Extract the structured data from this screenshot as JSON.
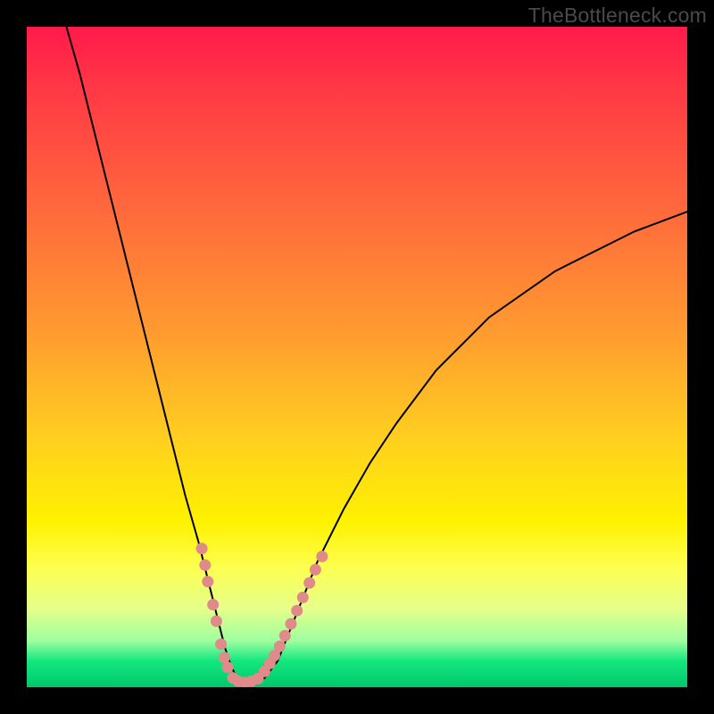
{
  "watermark": "TheBottleneck.com",
  "chart_data": {
    "type": "line",
    "title": "",
    "xlabel": "",
    "ylabel": "",
    "xlim": [
      0,
      100
    ],
    "ylim": [
      0,
      100
    ],
    "curve": {
      "name": "bottleneck-curve",
      "x": [
        6,
        8,
        10,
        12,
        14,
        16,
        18,
        20,
        22,
        24,
        26,
        28,
        29,
        30,
        31,
        32,
        33,
        34,
        36,
        38,
        40,
        44,
        48,
        52,
        56,
        62,
        70,
        80,
        92,
        100
      ],
      "y": [
        100,
        93,
        85,
        77,
        69,
        61,
        53,
        45,
        37,
        29,
        22,
        14,
        10,
        6,
        3,
        1.2,
        0.7,
        0.7,
        1.4,
        4,
        9,
        19,
        27,
        34,
        40,
        48,
        56,
        63,
        69,
        72
      ]
    },
    "marker_groups": [
      {
        "name": "left-edge-markers",
        "points": [
          {
            "x": 26.5,
            "y": 21
          },
          {
            "x": 27.0,
            "y": 18.5
          },
          {
            "x": 27.4,
            "y": 16
          },
          {
            "x": 28.2,
            "y": 12.5
          },
          {
            "x": 28.7,
            "y": 10
          },
          {
            "x": 29.4,
            "y": 6.5
          },
          {
            "x": 29.9,
            "y": 4.5
          },
          {
            "x": 30.4,
            "y": 3.0
          }
        ]
      },
      {
        "name": "trough-markers",
        "points": [
          {
            "x": 31.2,
            "y": 1.4
          },
          {
            "x": 32.0,
            "y": 0.9
          },
          {
            "x": 33.0,
            "y": 0.7
          },
          {
            "x": 34.0,
            "y": 0.9
          },
          {
            "x": 35.0,
            "y": 1.3
          }
        ]
      },
      {
        "name": "right-edge-markers",
        "points": [
          {
            "x": 36.0,
            "y": 2.4
          },
          {
            "x": 36.8,
            "y": 3.6
          },
          {
            "x": 37.5,
            "y": 4.8
          },
          {
            "x": 38.3,
            "y": 6.2
          },
          {
            "x": 39.1,
            "y": 7.8
          },
          {
            "x": 40.0,
            "y": 9.6
          },
          {
            "x": 40.9,
            "y": 11.6
          },
          {
            "x": 41.8,
            "y": 13.6
          },
          {
            "x": 42.8,
            "y": 15.8
          },
          {
            "x": 43.7,
            "y": 17.8
          },
          {
            "x": 44.7,
            "y": 19.8
          }
        ]
      }
    ]
  }
}
